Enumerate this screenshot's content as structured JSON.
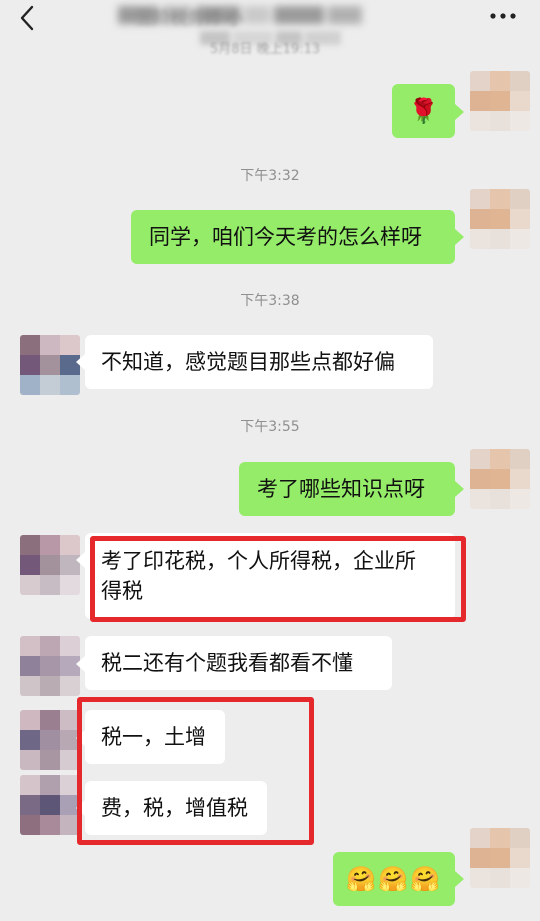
{
  "header": {
    "title": "三阶税务师·小",
    "subtitle": "5月8日 晚上19:13"
  },
  "colors": {
    "background": "#ededed",
    "sent_bubble": "#95ec69",
    "received_bubble": "#ffffff",
    "timestamp": "#8f8f8f",
    "highlight_box": "#e4282b"
  },
  "icons": {
    "back": "chevron-left-icon",
    "more": "more-dots-icon",
    "rose": "rose-emoji",
    "hug": "hug-emoji"
  },
  "messages": {
    "m1": {
      "from": "me",
      "emoji": "🌹"
    },
    "t1": "下午3:32",
    "m2": {
      "from": "me",
      "text": "同学，咱们今天考的怎么样呀"
    },
    "t2": "下午3:38",
    "m3": {
      "from": "other",
      "text": "不知道，感觉题目那些点都好偏"
    },
    "t3": "下午3:55",
    "m4": {
      "from": "me",
      "text": "考了哪些知识点呀"
    },
    "m5": {
      "from": "other",
      "line1": "考了印花税，个人所得税，企业所",
      "line2": "得税"
    },
    "m6": {
      "from": "other",
      "text": "税二还有个题我看都看不懂"
    },
    "m7": {
      "from": "other",
      "text": "税一，土增"
    },
    "m8": {
      "from": "other",
      "text": "费，税，增值税"
    },
    "m9": {
      "from": "me",
      "emoji": "🤗🤗🤗"
    }
  }
}
